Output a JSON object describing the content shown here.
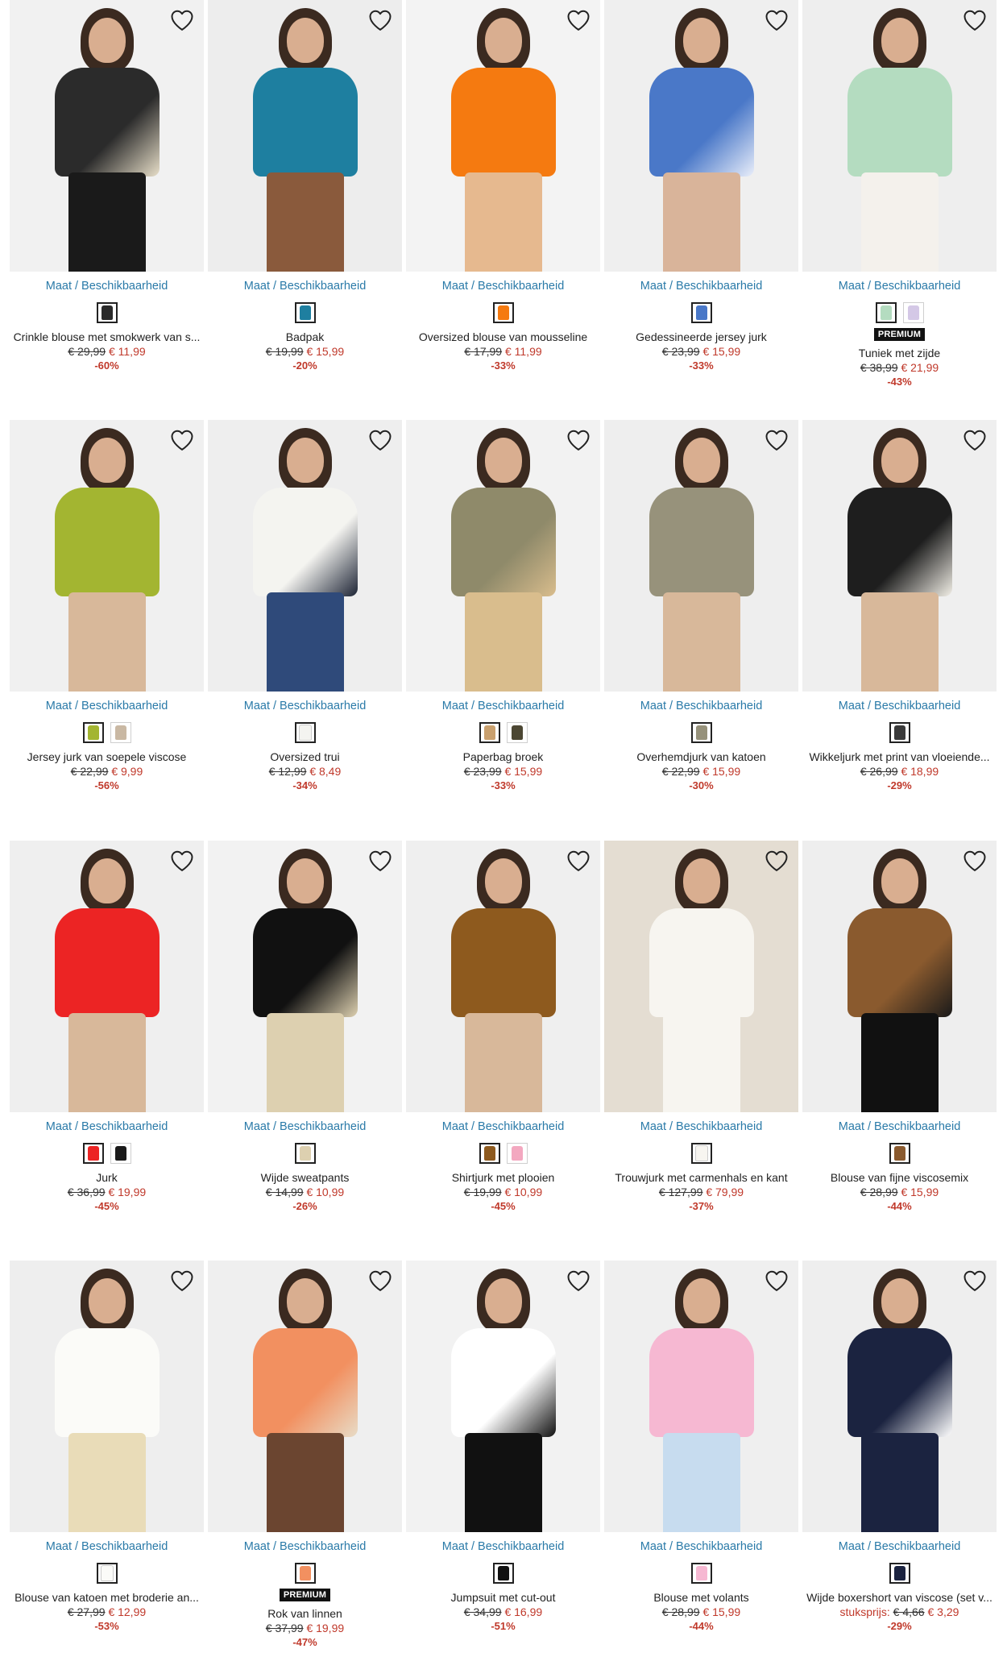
{
  "size_link_label": "Maat / Beschikbaarheid",
  "premium_label": "PREMIUM",
  "colors": {
    "link": "#2a7aa8",
    "sale": "#c0392b"
  },
  "products": [
    {
      "name": "Crinkle blouse met smokwerk van s...",
      "old_price": "€ 29,99",
      "new_price": "€ 11,99",
      "discount": "-60%",
      "unit": "",
      "premium": false,
      "garment": "#2b2b2b",
      "accent": "#e8dfc9",
      "pants": "#1a1a1a",
      "bg": "#f1f1f1",
      "swatches": [
        "#2b2b2b"
      ]
    },
    {
      "name": "Badpak",
      "old_price": "€ 19,99",
      "new_price": "€ 15,99",
      "discount": "-20%",
      "unit": "",
      "premium": false,
      "garment": "#1e7fa0",
      "accent": "#1e7fa0",
      "pants": "#8a5a3c",
      "bg": "#ededed",
      "swatches": [
        "#1e7fa0"
      ]
    },
    {
      "name": "Oversized blouse van mousseline",
      "old_price": "€ 17,99",
      "new_price": "€ 11,99",
      "discount": "-33%",
      "unit": "",
      "premium": false,
      "garment": "#f57a10",
      "accent": "#f57a10",
      "pants": "#e6b98f",
      "bg": "#f3f3f3",
      "swatches": [
        "#f57a10"
      ]
    },
    {
      "name": "Gedessineerde jersey jurk",
      "old_price": "€ 23,99",
      "new_price": "€ 15,99",
      "discount": "-33%",
      "unit": "",
      "premium": false,
      "garment": "#4a78c8",
      "accent": "#e9eefa",
      "pants": "#d9b49a",
      "bg": "#efefef",
      "swatches": [
        "#4a78c8"
      ]
    },
    {
      "name": "Tuniek met zijde",
      "old_price": "€ 38,99",
      "new_price": "€ 21,99",
      "discount": "-43%",
      "unit": "",
      "premium": true,
      "garment": "#b4dcc0",
      "accent": "#b4dcc0",
      "pants": "#f4f1ec",
      "bg": "#eeeeee",
      "swatches": [
        "#b4dcc0",
        "#d4c8e6"
      ]
    },
    {
      "name": "Jersey jurk van soepele viscose",
      "old_price": "€ 22,99",
      "new_price": "€ 9,99",
      "discount": "-56%",
      "unit": "",
      "premium": false,
      "garment": "#a3b531",
      "accent": "#a3b531",
      "pants": "#d8b89a",
      "bg": "#f0f0f0",
      "swatches": [
        "#a3b531",
        "#c9b8a3"
      ]
    },
    {
      "name": "Oversized trui",
      "old_price": "€ 12,99",
      "new_price": "€ 8,49",
      "discount": "-34%",
      "unit": "",
      "premium": false,
      "garment": "#f4f4f0",
      "accent": "#1d2435",
      "pants": "#2f4a7a",
      "bg": "#eeeeee",
      "swatches": [
        "#f4f4f0"
      ]
    },
    {
      "name": "Paperbag broek",
      "old_price": "€ 23,99",
      "new_price": "€ 15,99",
      "discount": "-33%",
      "unit": "",
      "premium": false,
      "garment": "#8f8a6a",
      "accent": "#d9bd8d",
      "pants": "#d9bd8d",
      "bg": "#f2f2f2",
      "swatches": [
        "#c9a06e",
        "#4c4733"
      ]
    },
    {
      "name": "Overhemdjurk van katoen",
      "old_price": "€ 22,99",
      "new_price": "€ 15,99",
      "discount": "-30%",
      "unit": "",
      "premium": false,
      "garment": "#97927b",
      "accent": "#97927b",
      "pants": "#d8b89a",
      "bg": "#eeeeee",
      "swatches": [
        "#97927b"
      ]
    },
    {
      "name": "Wikkeljurk met print van vloeiende...",
      "old_price": "€ 26,99",
      "new_price": "€ 18,99",
      "discount": "-29%",
      "unit": "",
      "premium": false,
      "garment": "#1e1e1e",
      "accent": "#f2efe7",
      "pants": "#d8b89a",
      "bg": "#efefef",
      "swatches": [
        "#3a3a3a"
      ]
    },
    {
      "name": "Jurk",
      "old_price": "€ 36,99",
      "new_price": "€ 19,99",
      "discount": "-45%",
      "unit": "",
      "premium": false,
      "garment": "#ec2424",
      "accent": "#ec2424",
      "pants": "#d8b89a",
      "bg": "#efefef",
      "swatches": [
        "#ec2424",
        "#1a1a1a"
      ]
    },
    {
      "name": "Wijde sweatpants",
      "old_price": "€ 14,99",
      "new_price": "€ 10,99",
      "discount": "-26%",
      "unit": "",
      "premium": false,
      "garment": "#111111",
      "accent": "#ddd0b0",
      "pants": "#ddd0b0",
      "bg": "#f2f2f2",
      "swatches": [
        "#ddd0b0"
      ]
    },
    {
      "name": "Shirtjurk met plooien",
      "old_price": "€ 19,99",
      "new_price": "€ 10,99",
      "discount": "-45%",
      "unit": "",
      "premium": false,
      "garment": "#8e5a1e",
      "accent": "#8e5a1e",
      "pants": "#d8b89a",
      "bg": "#efefef",
      "swatches": [
        "#8e5a1e",
        "#f3a8c0"
      ]
    },
    {
      "name": "Trouwjurk met carmenhals en kant",
      "old_price": "€ 127,99",
      "new_price": "€ 79,99",
      "discount": "-37%",
      "unit": "",
      "premium": false,
      "garment": "#f7f5f0",
      "accent": "#f7f5f0",
      "pants": "#f7f5f0",
      "bg": "#e4ddd2",
      "swatches": [
        "#f7f5f0"
      ]
    },
    {
      "name": "Blouse van fijne viscosemix",
      "old_price": "€ 28,99",
      "new_price": "€ 15,99",
      "discount": "-44%",
      "unit": "",
      "premium": false,
      "garment": "#8a5a2e",
      "accent": "#1a1a1a",
      "pants": "#111111",
      "bg": "#eeeeee",
      "swatches": [
        "#8a5a2e"
      ]
    },
    {
      "name": "Blouse van katoen met broderie an...",
      "old_price": "€ 27,99",
      "new_price": "€ 12,99",
      "discount": "-53%",
      "unit": "",
      "premium": false,
      "garment": "#fbfbf8",
      "accent": "#fbfbf8",
      "pants": "#e9dcb8",
      "bg": "#eeeeee",
      "swatches": [
        "#fbfbf8"
      ]
    },
    {
      "name": "Rok van linnen",
      "old_price": "€ 37,99",
      "new_price": "€ 19,99",
      "discount": "-47%",
      "unit": "",
      "premium": true,
      "garment": "#f29060",
      "accent": "#e8dcc7",
      "pants": "#6b4530",
      "bg": "#efefef",
      "swatches": [
        "#f29060"
      ]
    },
    {
      "name": "Jumpsuit met cut-out",
      "old_price": "€ 34,99",
      "new_price": "€ 16,99",
      "discount": "-51%",
      "unit": "",
      "premium": false,
      "garment": "#ffffff",
      "accent": "#111111",
      "pants": "#111111",
      "bg": "#f2f2f2",
      "swatches": [
        "#111111"
      ]
    },
    {
      "name": "Blouse met volants",
      "old_price": "€ 28,99",
      "new_price": "€ 15,99",
      "discount": "-44%",
      "unit": "",
      "premium": false,
      "garment": "#f6b8d2",
      "accent": "#f6b8d2",
      "pants": "#c7dcef",
      "bg": "#efefef",
      "swatches": [
        "#f6b8d2"
      ]
    },
    {
      "name": "Wijde boxershort van viscose (set v...",
      "old_price": "€ 4,66",
      "new_price": "€ 3,29",
      "discount": "-29%",
      "unit": "stuksprijs:",
      "premium": false,
      "garment": "#1b2340",
      "accent": "#ffffff",
      "pants": "#1b2340",
      "bg": "#eeeeee",
      "swatches": [
        "#1b2340"
      ]
    }
  ]
}
